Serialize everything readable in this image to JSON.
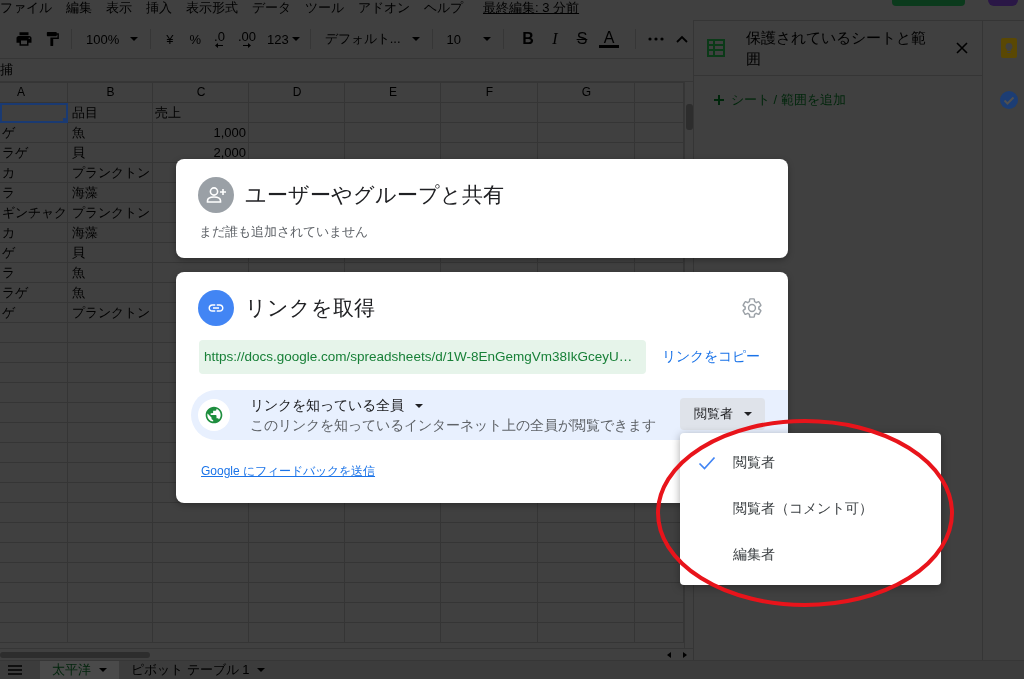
{
  "menu_bar": {
    "items": [
      "ファイル",
      "編集",
      "表示",
      "挿入",
      "表示形式",
      "データ",
      "ツール",
      "アドオン",
      "ヘルプ"
    ],
    "last_edit": "最終編集: 3 分前"
  },
  "toolbar": {
    "zoom": "100%",
    "currency": "¥",
    "percent": "%",
    "decrease_decimal": ".0",
    "increase_decimal": ".00",
    "number_format": "123",
    "font": "デフォルト...",
    "font_size": "10",
    "bold": "B",
    "italic": "I",
    "strikethrough": "S",
    "text_color": "A"
  },
  "formula_bar": {
    "text": "捕"
  },
  "sheet": {
    "columns": [
      "A",
      "B",
      "C",
      "D",
      "E",
      "F",
      "G"
    ],
    "rows": [
      {
        "cells": [
          {
            "kind": "text",
            "selected": true
          },
          {
            "kind": "text",
            "text": "品目",
            "selected": false
          },
          {
            "kind": "text",
            "text": "売上",
            "selected": false
          }
        ]
      },
      {
        "cells": [
          {
            "kind": "text",
            "text": "ゲ",
            "selected": false
          },
          {
            "kind": "text",
            "text": "魚",
            "selected": false
          },
          {
            "kind": "number",
            "text": "1,000",
            "selected": false
          }
        ]
      },
      {
        "cells": [
          {
            "kind": "text",
            "text": "ラゲ",
            "selected": false
          },
          {
            "kind": "text",
            "text": "貝",
            "selected": false
          },
          {
            "kind": "number",
            "text": "2,000",
            "selected": false
          }
        ]
      },
      {
        "cells": [
          {
            "kind": "text",
            "text": "カ",
            "selected": false
          },
          {
            "kind": "text",
            "text": "プランクトン",
            "selected": false
          }
        ]
      },
      {
        "cells": [
          {
            "kind": "text",
            "text": "ラ",
            "selected": false
          },
          {
            "kind": "text",
            "text": "海藻",
            "selected": false
          }
        ]
      },
      {
        "cells": [
          {
            "kind": "text",
            "text": "ギンチャク",
            "selected": false
          },
          {
            "kind": "text",
            "text": "プランクトン",
            "selected": false
          }
        ]
      },
      {
        "cells": [
          {
            "kind": "text",
            "text": "カ",
            "selected": false
          },
          {
            "kind": "text",
            "text": "海藻",
            "selected": false
          }
        ]
      },
      {
        "cells": [
          {
            "kind": "text",
            "text": "ゲ",
            "selected": false
          },
          {
            "kind": "text",
            "text": "貝",
            "selected": false
          }
        ]
      },
      {
        "cells": [
          {
            "kind": "text",
            "text": "ラ",
            "selected": false
          },
          {
            "kind": "text",
            "text": "魚",
            "selected": false
          }
        ]
      },
      {
        "cells": [
          {
            "kind": "text",
            "text": "ラゲ",
            "selected": false
          },
          {
            "kind": "text",
            "text": "魚",
            "selected": false
          }
        ]
      },
      {
        "cells": [
          {
            "kind": "text",
            "text": "ゲ",
            "selected": false
          },
          {
            "kind": "text",
            "text": "プランクトン",
            "selected": false
          }
        ]
      }
    ]
  },
  "side_panel": {
    "title": "保護されているシートと範囲",
    "add_action": "シート / 範囲を追加"
  },
  "sheet_tabs": [
    {
      "label": "太平洋",
      "selected": true
    },
    {
      "label": "ピボット テーブル 1",
      "selected": false
    }
  ],
  "share_dialog": {
    "people": {
      "title": "ユーザーやグループと共有",
      "status": "まだ誰も追加されていません"
    },
    "link": {
      "title": "リンクを取得",
      "url": "https://docs.google.com/spreadsheets/d/1W-8EnGemgVm38IkGceyU…",
      "copy_label": "リンクをコピー",
      "access": {
        "scope": "リンクを知っている全員",
        "description": "このリンクを知っているインターネット上の全員が閲覧できます",
        "role": "閲覧者"
      },
      "feedback_link": "Google にフィードバックを送信"
    }
  },
  "role_menu": {
    "items": [
      {
        "label": "閲覧者",
        "selected": true
      },
      {
        "label": "閲覧者（コメント可）",
        "selected": false
      },
      {
        "label": "編集者",
        "selected": false
      }
    ]
  }
}
